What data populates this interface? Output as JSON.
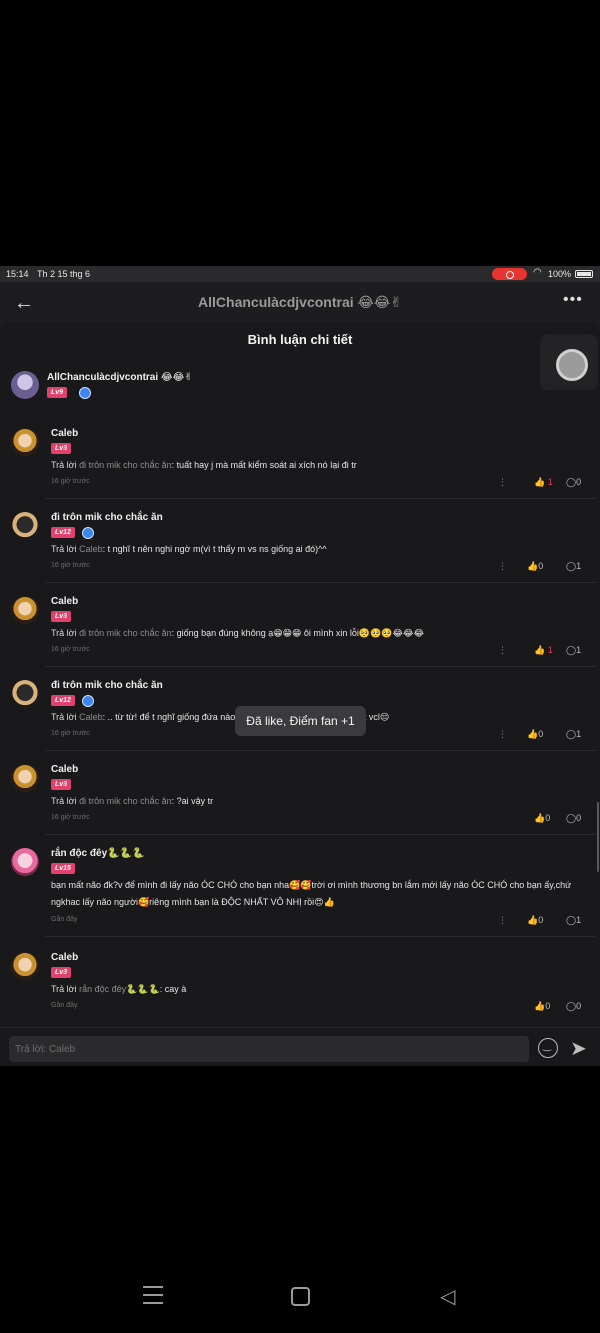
{
  "status_bar": {
    "time": "15:14",
    "date": "Th 2 15 thg 6",
    "battery": "100%"
  },
  "app_bar": {
    "title": "AllChanculàcdjvcontrai 😂😂✌"
  },
  "sheet": {
    "title": "Bình luận chi tiết"
  },
  "main_comment": {
    "name": "AllChanculàcdjvcontrai 😂😂✌",
    "level": "Lv9"
  },
  "comments": [
    {
      "name": "Caleb",
      "level": "Lv3",
      "reply_prefix": "Trả lời ",
      "reply_to": "đi trôn mik cho chắc ăn",
      "text": ": tuất hay j mà mất kiểm soát ai xích nó lại đi tr",
      "time": "16 giờ trước",
      "likes": "1",
      "comments": "0",
      "liked": true
    },
    {
      "name": "đi trôn mik cho chắc ăn",
      "level": "Lv12",
      "reply_prefix": "Trả lời ",
      "reply_to": "Caleb",
      "text": ": t nghĩ t nên nghi ngờ m(vì t thấy m vs ns giống ai đó)^^",
      "time": "16 giờ trước",
      "likes": "0",
      "comments": "1",
      "liked": false
    },
    {
      "name": "Caleb",
      "level": "Lv3",
      "reply_prefix": "Trả lời ",
      "reply_to": "đi trôn mik cho chắc ăn",
      "text": ": giống bạn đúng không ạ😁😁😁 ôi mình xin lỗi🥺🥺🥺😂😂😂",
      "time": "16 giờ trước",
      "likes": "1",
      "comments": "1",
      "liked": true
    },
    {
      "name": "đi trôn mik cho chắc ăn",
      "level": "Lv12",
      "reply_prefix": "Trả lời ",
      "reply_to": "Caleb",
      "text": ": .. từ từ! để t nghĩ giống đứa nào đó chứ hai m giống cái thg bạn t vcl😔",
      "time": "16 giờ trước",
      "likes": "0",
      "comments": "1",
      "liked": false
    },
    {
      "name": "Caleb",
      "level": "Lv3",
      "reply_prefix": "Trả lời ",
      "reply_to": "đi trôn mik cho chắc ăn",
      "text": ": ?ai vậy tr",
      "time": "16 giờ trước",
      "likes": "0",
      "comments": "0",
      "liked": false
    },
    {
      "name": "rắn độc đêy🐍🐍🐍",
      "level": "Lv15",
      "reply_prefix": "",
      "reply_to": "",
      "text": "bạn mất não đk?v để mình đi lấy não ÓC CHÓ cho bạn nha🥰🥰trời ơi mình thương bn lắm mới lấy não ÓC CHÓ cho bạn ấy,chứ ngkhac lấy não người🥰riêng mình bạn là ĐỘC NHẤT VÔ NHỊ rồi😍👍",
      "time": "Gần đây",
      "likes": "0",
      "comments": "1",
      "liked": false
    },
    {
      "name": "Caleb",
      "level": "Lv3",
      "reply_prefix": "Trả lời ",
      "reply_to": "rắn độc đêy🐍🐍🐍",
      "text": ": cay à",
      "time": "Gần đây",
      "likes": "0",
      "comments": "0",
      "liked": false
    }
  ],
  "toast": "Đã like, Điểm fan +1",
  "reply_bar": {
    "placeholder": "Trả lời: Caleb"
  },
  "icons": {
    "back": "arrow-left-icon",
    "more": "more-dots-icon",
    "close": "close-icon",
    "like": "thumb-up-icon",
    "comment": "comment-bubble-icon",
    "emoji": "emoji-icon",
    "send": "send-icon"
  },
  "colors": {
    "accent_like": "#ee3a5e",
    "level_badge": "#e2416b",
    "background": "#19191b"
  }
}
